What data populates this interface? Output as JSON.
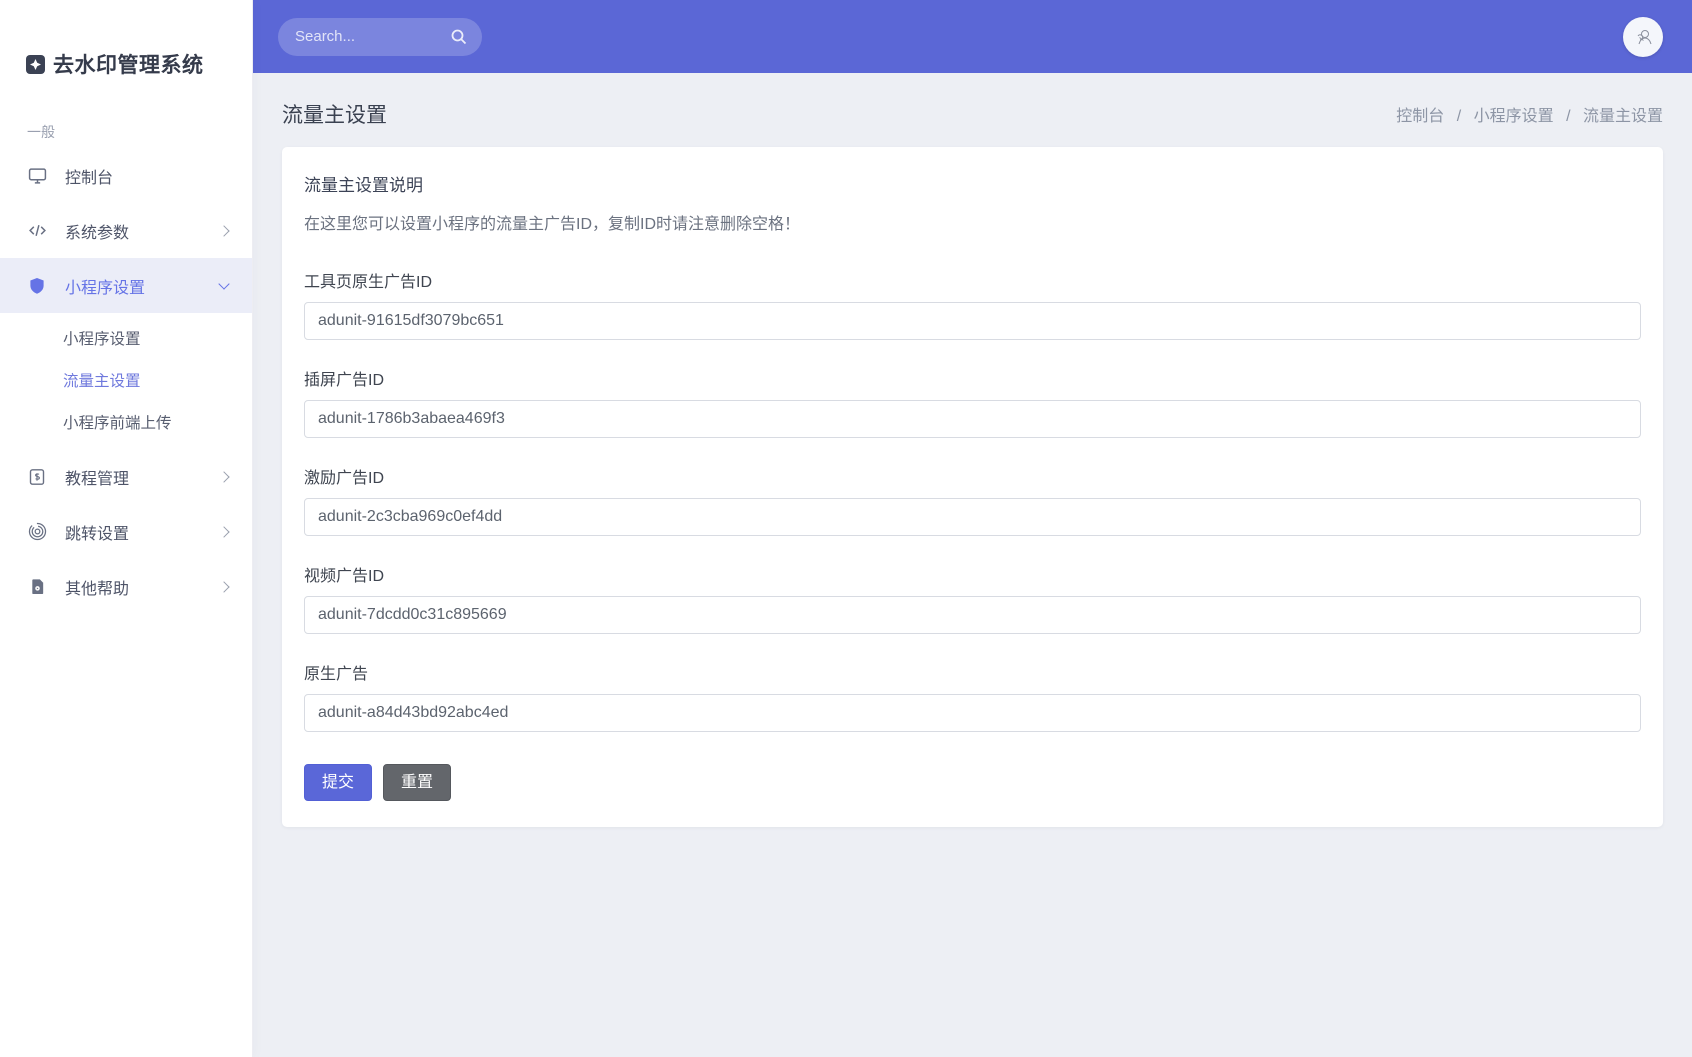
{
  "app": {
    "title": "去水印管理系统"
  },
  "topbar": {
    "search_placeholder": "Search..."
  },
  "sidebar": {
    "section_label": "一般",
    "items": [
      {
        "label": "控制台"
      },
      {
        "label": "系统参数"
      },
      {
        "label": "小程序设置",
        "children": [
          "小程序设置",
          "流量主设置",
          "小程序前端上传"
        ]
      },
      {
        "label": "教程管理"
      },
      {
        "label": "跳转设置"
      },
      {
        "label": "其他帮助"
      }
    ]
  },
  "page": {
    "title": "流量主设置",
    "breadcrumb": [
      "控制台",
      "小程序设置",
      "流量主设置"
    ],
    "separator": "/"
  },
  "card": {
    "title": "流量主设置说明",
    "description": "在这里您可以设置小程序的流量主广告ID，复制ID时请注意删除空格！",
    "fields": [
      {
        "label": "工具页原生广告ID",
        "value": "adunit-91615df3079bc651"
      },
      {
        "label": "插屏广告ID",
        "value": "adunit-1786b3abaea469f3"
      },
      {
        "label": "激励广告ID",
        "value": "adunit-2c3cba969c0ef4dd"
      },
      {
        "label": "视频广告ID",
        "value": "adunit-7dcdd0c31c895669"
      },
      {
        "label": "原生广告",
        "value": "adunit-a84d43bd92abc4ed"
      }
    ],
    "buttons": {
      "submit": "提交",
      "reset": "重置"
    }
  },
  "colors": {
    "topbar": "#5b67d6",
    "accent": "#6573e6",
    "submit_button": "#5a67d8",
    "reset_button": "#63666b",
    "content_background": "#edeff4"
  }
}
